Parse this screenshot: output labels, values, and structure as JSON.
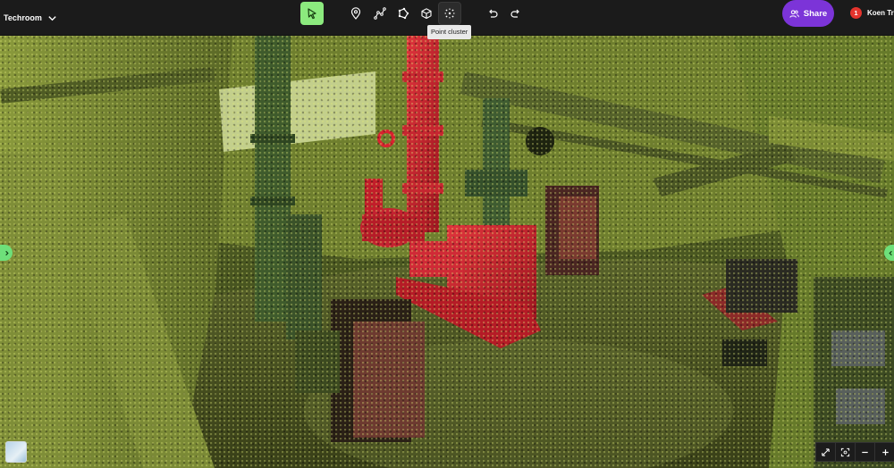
{
  "project": {
    "name": "Techroom"
  },
  "toolbar": {
    "tools": [
      {
        "id": "select",
        "icon": "cursor-arrow-icon",
        "active": true
      },
      {
        "id": "poi",
        "icon": "map-pin-icon"
      },
      {
        "id": "polyline",
        "icon": "polyline-icon"
      },
      {
        "id": "polygon",
        "icon": "polygon-icon"
      },
      {
        "id": "box",
        "icon": "cube-icon"
      },
      {
        "id": "point-cluster",
        "icon": "point-cluster-icon",
        "hovered": true
      },
      {
        "id": "undo",
        "icon": "undo-icon"
      },
      {
        "id": "redo",
        "icon": "redo-icon"
      }
    ],
    "tooltip": "Point cluster"
  },
  "share": {
    "label": "Share",
    "icon": "users-icon",
    "color": "#7c34d8"
  },
  "user": {
    "badge": "1",
    "name": "Koen Tru"
  },
  "colors": {
    "accent": "#8cea7e",
    "selection": "#d8222f",
    "brand": "#7c34d8"
  }
}
